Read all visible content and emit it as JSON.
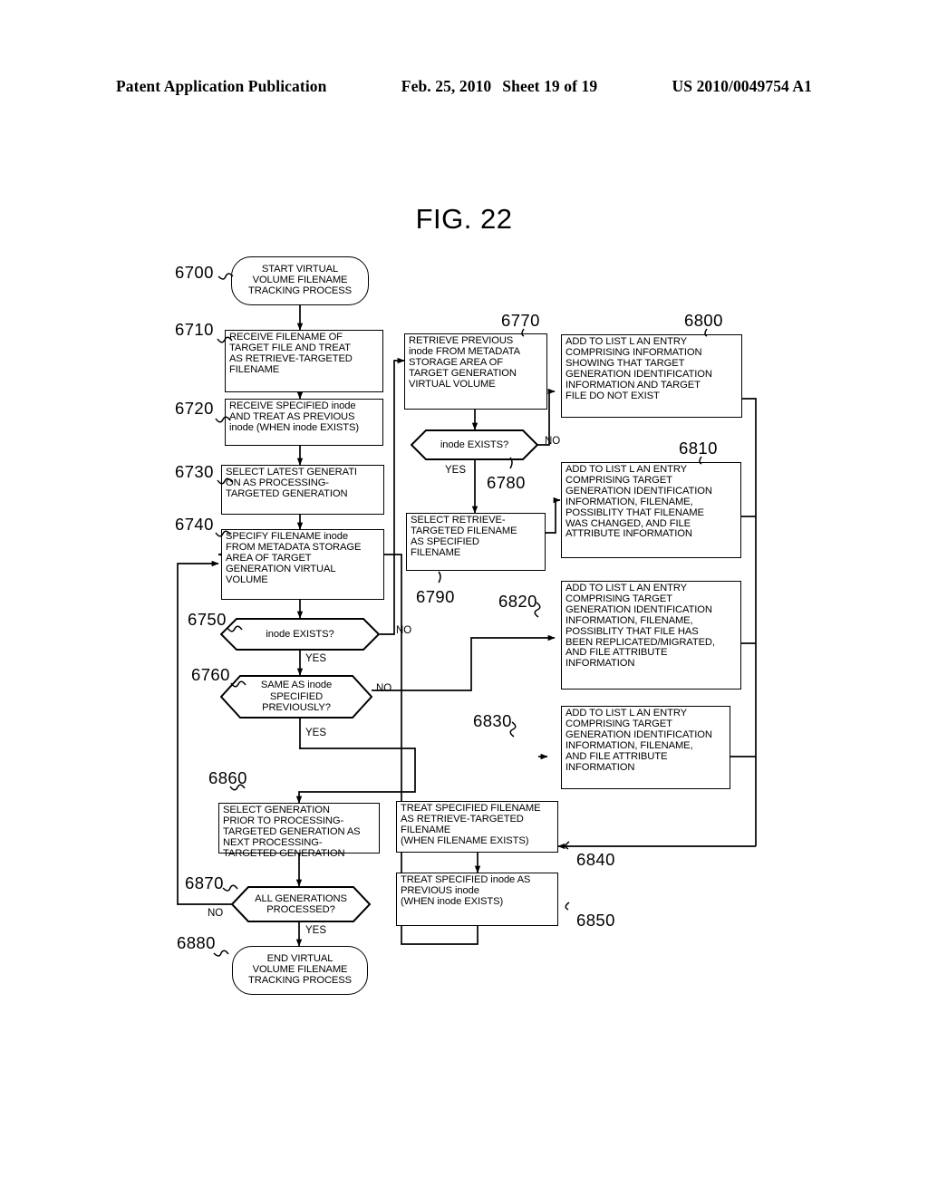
{
  "header": {
    "left": "Patent Application Publication",
    "date": "Feb. 25, 2010",
    "sheet": "Sheet 19 of 19",
    "patent_number": "US 2010/0049754 A1"
  },
  "figure": {
    "title": "FIG. 22"
  },
  "nodes": {
    "n6700": "START VIRTUAL\nVOLUME FILENAME\nTRACKING PROCESS",
    "n6710": "RECEIVE FILENAME OF\nTARGET FILE AND TREAT\nAS RETRIEVE-TARGETED\nFILENAME",
    "n6720": "RECEIVE SPECIFIED inode\nAND TREAT AS PREVIOUS\ninode (WHEN inode EXISTS)",
    "n6730": "SELECT LATEST GENERATI\nON AS PROCESSING-\nTARGETED GENERATION",
    "n6740": "SPECIFY FILENAME inode\nFROM METADATA STORAGE\nAREA OF TARGET\nGENERATION VIRTUAL\nVOLUME",
    "n6750": "inode EXISTS?",
    "n6760": "SAME AS inode\nSPECIFIED\nPREVIOUSLY?",
    "n6770": "RETRIEVE PREVIOUS\ninode FROM METADATA\nSTORAGE AREA OF\nTARGET GENERATION\nVIRTUAL VOLUME",
    "n6780": "inode EXISTS?",
    "n6790": "SELECT RETRIEVE-\nTARGETED FILENAME\nAS SPECIFIED\nFILENAME",
    "n6800": "ADD TO LIST L AN ENTRY\nCOMPRISING INFORMATION\nSHOWING THAT TARGET\nGENERATION IDENTIFICATION\nINFORMATION AND TARGET\nFILE DO NOT EXIST",
    "n6810": "ADD TO LIST L AN ENTRY\nCOMPRISING TARGET\nGENERATION IDENTIFICATION\nINFORMATION, FILENAME,\nPOSSIBLITY THAT FILENAME\nWAS CHANGED, AND FILE\nATTRIBUTE INFORMATION",
    "n6820": "ADD TO LIST L AN ENTRY\nCOMPRISING TARGET\nGENERATION IDENTIFICATION\nINFORMATION, FILENAME,\nPOSSIBLITY THAT FILE HAS\nBEEN REPLICATED/MIGRATED,\nAND FILE ATTRIBUTE\nINFORMATION",
    "n6830": "ADD TO LIST L AN ENTRY\nCOMPRISING TARGET\nGENERATION IDENTIFICATION\nINFORMATION, FILENAME,\nAND FILE ATTRIBUTE\nINFORMATION",
    "n6840": "TREAT SPECIFIED FILENAME\nAS RETRIEVE-TARGETED\nFILENAME\n(WHEN FILENAME EXISTS)",
    "n6850": "TREAT SPECIFIED inode AS\nPREVIOUS inode\n(WHEN inode EXISTS)",
    "n6860": "SELECT GENERATION\nPRIOR TO PROCESSING-\nTARGETED GENERATION AS\nNEXT PROCESSING-\nTARGETED GENERATION",
    "n6870": "ALL GENERATIONS\nPROCESSED?",
    "n6880": "END VIRTUAL\nVOLUME FILENAME\nTRACKING PROCESS"
  },
  "refs": {
    "r6700": "6700",
    "r6710": "6710",
    "r6720": "6720",
    "r6730": "6730",
    "r6740": "6740",
    "r6750": "6750",
    "r6760": "6760",
    "r6770": "6770",
    "r6780": "6780",
    "r6790": "6790",
    "r6800": "6800",
    "r6810": "6810",
    "r6820": "6820",
    "r6830": "6830",
    "r6840": "6840",
    "r6850": "6850",
    "r6860": "6860",
    "r6870": "6870",
    "r6880": "6880"
  },
  "edge_labels": {
    "e6750_no": "NO",
    "e6750_yes": "YES",
    "e6760_no": "NO",
    "e6760_yes": "YES",
    "e6780_no": "NO",
    "e6780_yes": "YES",
    "e6870_no": "NO",
    "e6870_yes": "YES"
  },
  "colors": {
    "ink": "#000000",
    "paper": "#ffffff"
  }
}
